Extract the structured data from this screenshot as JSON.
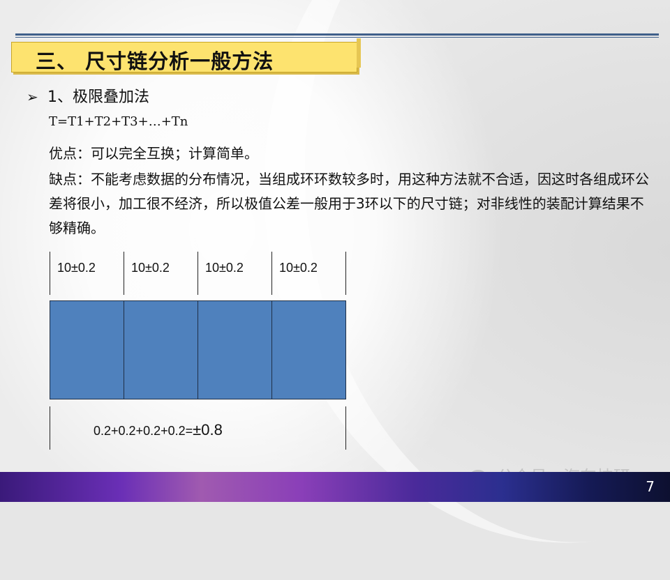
{
  "title": "三、  尺寸链分析一般方法",
  "bullet": {
    "marker": "➢",
    "text": "1、极限叠加法"
  },
  "formula": "T=T1+T2+T3+…+Tn",
  "pros": "优点：可以完全互换；计算简单。",
  "cons": "缺点：不能考虑数据的分布情况，当组成环环数较多时，用这种方法就不合适，因这时各组成环公差将很小，加工很不经济，所以极值公差一般用于3环以下的尺寸链；对非线性的装配计算结果不够精确。",
  "diagram": {
    "tolerances": [
      "10±0.2",
      "10±0.2",
      "10±0.2",
      "10±0.2"
    ],
    "total_sum": "0.2+0.2+0.2+0.2=",
    "total_value": "±0.8",
    "block_color": "#4f81bd"
  },
  "watermark": "公众号 · 汽车技研",
  "page_number": "7"
}
